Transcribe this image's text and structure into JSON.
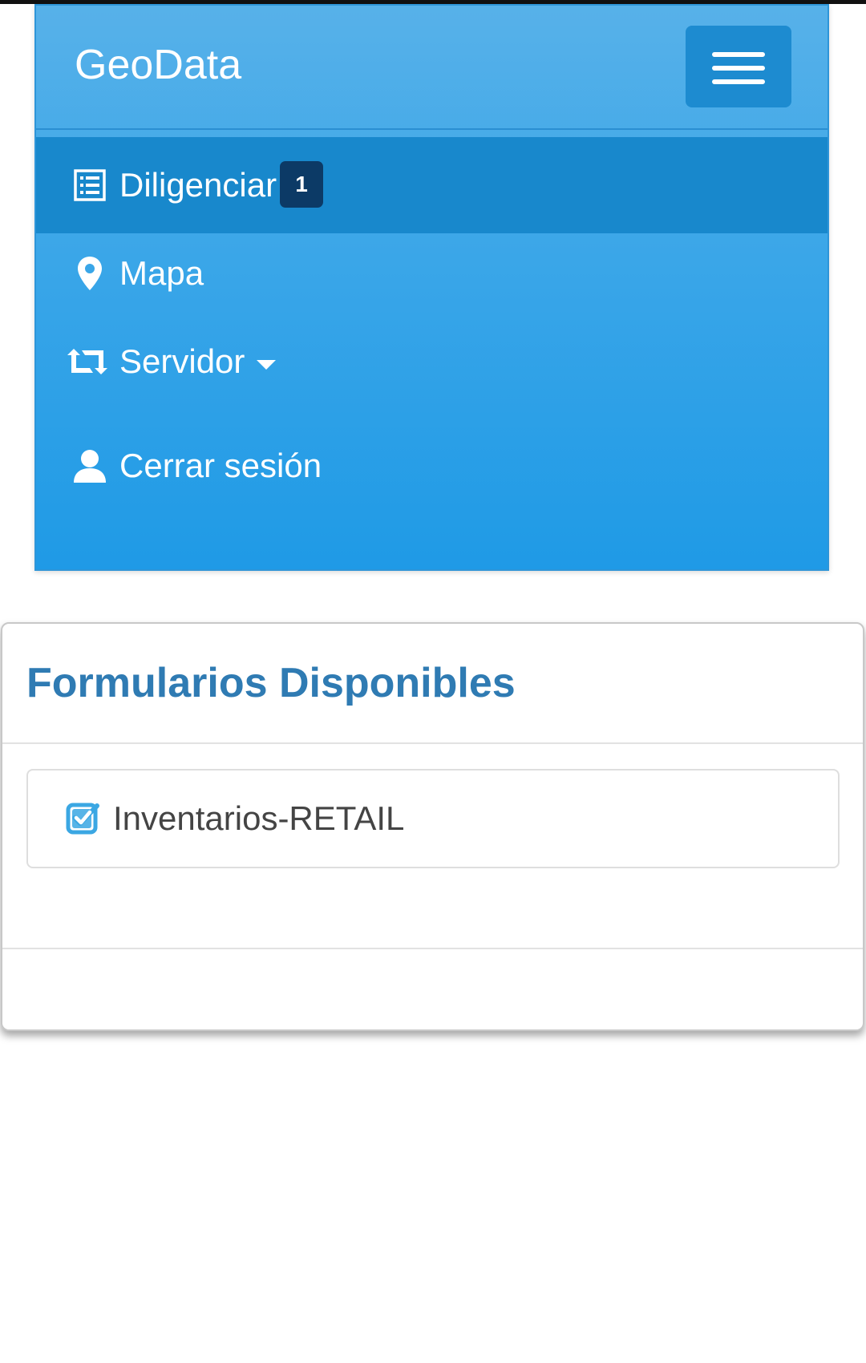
{
  "navbar": {
    "brand": "GeoData",
    "toggle_icon": "hamburger-menu-icon",
    "items": [
      {
        "label": "Diligenciar",
        "icon": "list-icon",
        "badge": "1",
        "active": true
      },
      {
        "label": "Mapa",
        "icon": "map-marker-icon"
      },
      {
        "label": "Servidor",
        "icon": "retweet-icon",
        "dropdown": true
      },
      {
        "label": "Cerrar sesión",
        "icon": "user-icon"
      }
    ]
  },
  "panel": {
    "title": "Formularios Disponibles",
    "forms": [
      {
        "label": "Inventarios-RETAIL",
        "icon": "check-square-icon"
      }
    ]
  },
  "colors": {
    "navbar_top": "#57b1e9",
    "navbar_bottom": "#1f9ae6",
    "active_item": "#1888cc",
    "badge": "#0c3a66",
    "panel_title": "#2f7bb3",
    "check": "#3ba7e3"
  }
}
